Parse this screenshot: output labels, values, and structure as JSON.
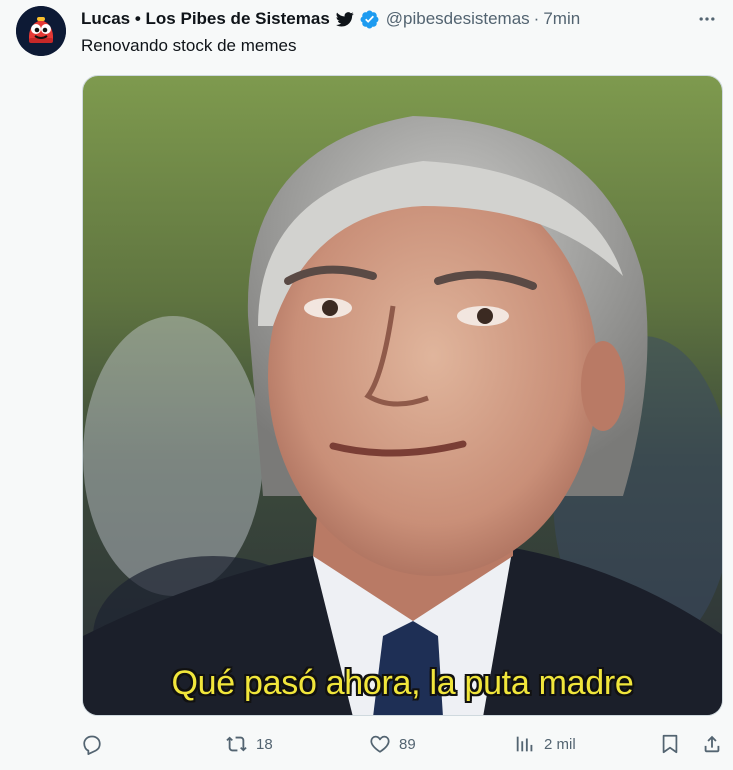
{
  "tweet": {
    "display_name": "Lucas • Los Pibes de Sistemas",
    "handle": "@pibesdesistemas",
    "separator": "·",
    "time": "7min",
    "text": "Renovando stock de memes",
    "media_caption": "Qué pasó ahora, la puta madre"
  },
  "actions": {
    "reply_count": "",
    "retweet_count": "18",
    "like_count": "89",
    "views_count": "2 mil"
  },
  "icons": {
    "bird": "bird-icon",
    "verified": "verified-badge-icon",
    "more": "more-options-icon",
    "reply": "reply-icon",
    "retweet": "retweet-icon",
    "like": "heart-icon",
    "views": "views-chart-icon",
    "bookmark": "bookmark-icon",
    "share": "share-icon"
  },
  "colors": {
    "verified_blue": "#1d9bf0",
    "text_primary": "#0f1419",
    "text_secondary": "#536471",
    "caption_yellow": "#f1e63b"
  }
}
